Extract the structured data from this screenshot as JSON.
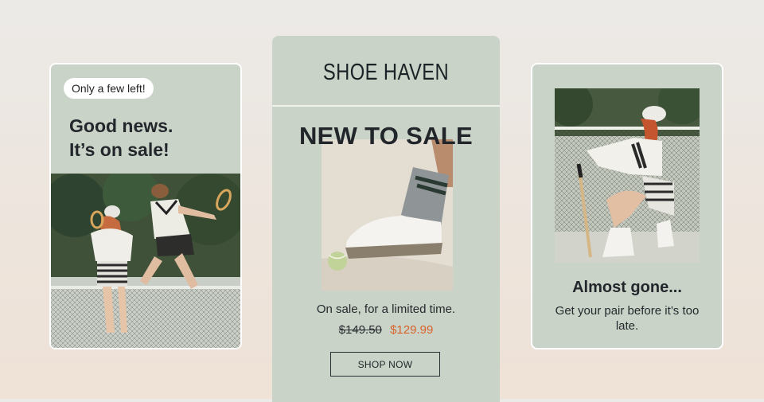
{
  "left_card": {
    "badge": "Only a few left!",
    "headline_line1": "Good news.",
    "headline_line2": "It’s on sale!",
    "photo_alt": "tennis players photo"
  },
  "center_card": {
    "brand": "SHOE HAVEN",
    "title": "NEW TO SALE",
    "tagline": "On sale, for a limited time.",
    "old_price": "$149.50",
    "new_price": "$129.99",
    "button_label": "SHOP NOW"
  },
  "right_card": {
    "headline": "Almost gone...",
    "subtext": "Get your pair before it’s too late."
  },
  "colors": {
    "card_bg": "#c9d3c8",
    "sale_price": "#d9622b",
    "text_dark": "#23272c"
  }
}
